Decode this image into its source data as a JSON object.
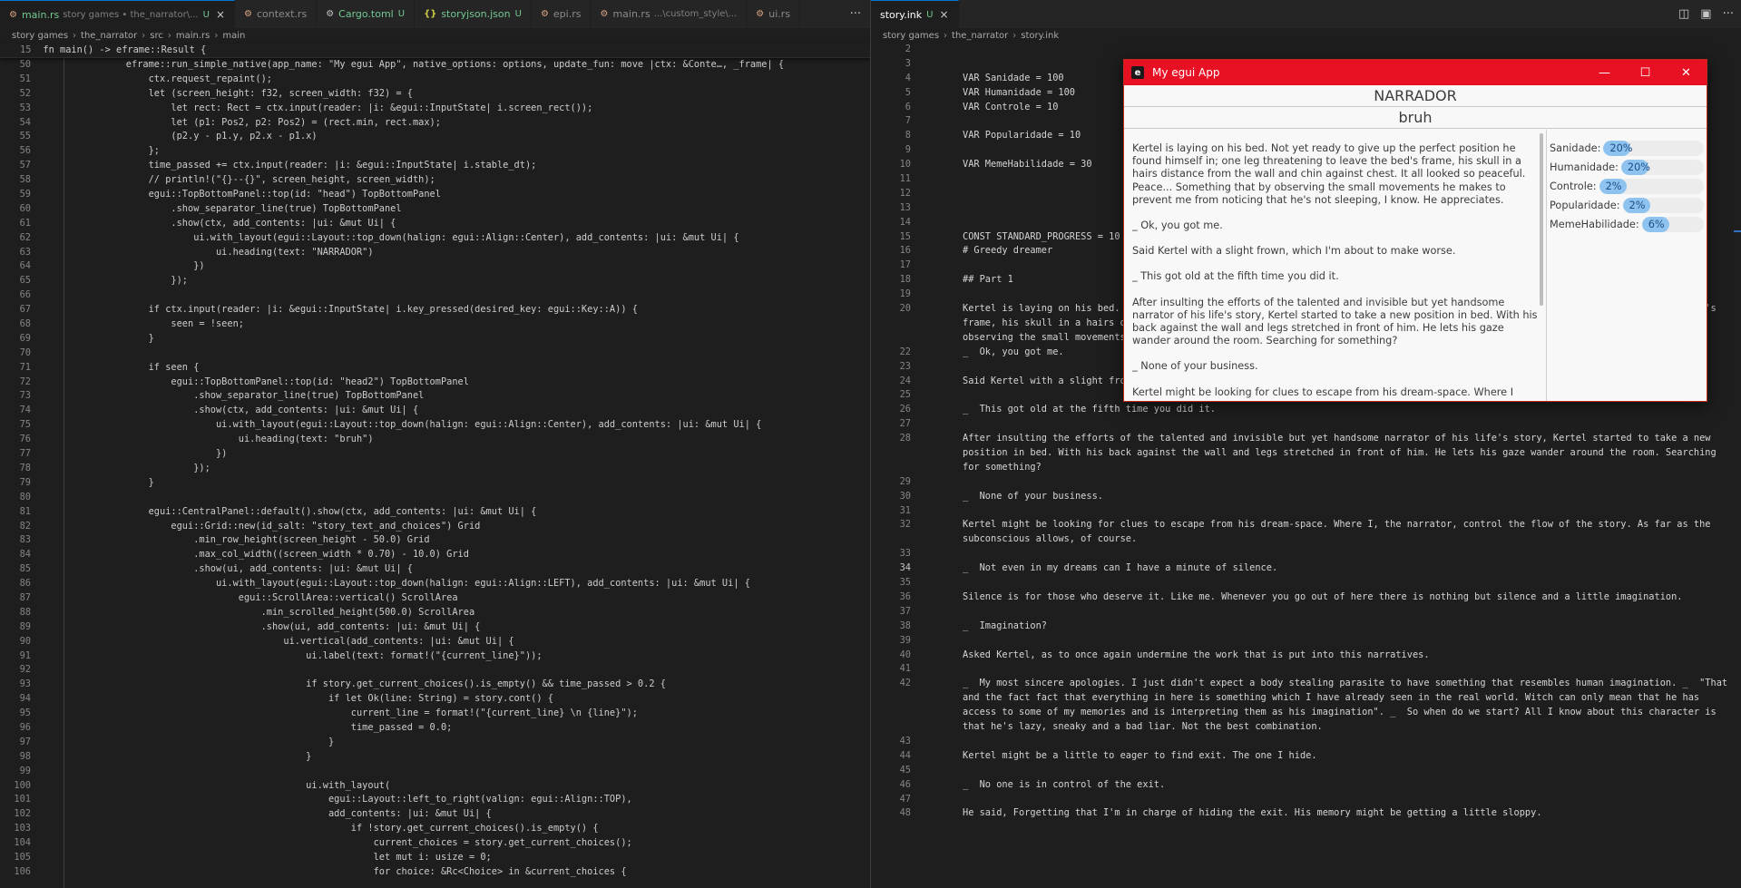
{
  "left": {
    "tabs": [
      {
        "label": "main.rs",
        "detail": "story games • the_narrator\\...",
        "status": "U",
        "icon": "rust-icon",
        "active": true
      },
      {
        "label": "context.rs",
        "detail": "",
        "status": "",
        "icon": "rust-icon",
        "active": false
      },
      {
        "label": "Cargo.toml",
        "detail": "",
        "status": "U",
        "icon": "gear-icon",
        "active": false
      },
      {
        "label": "storyjson.json",
        "detail": "",
        "status": "U",
        "icon": "json-icon",
        "active": false
      },
      {
        "label": "epi.rs",
        "detail": "",
        "status": "",
        "icon": "rust-icon",
        "active": false
      },
      {
        "label": "main.rs",
        "detail": "...\\custom_style\\...",
        "status": "",
        "icon": "rust-icon",
        "active": false
      },
      {
        "label": "ui.rs",
        "detail": "",
        "status": "",
        "icon": "rust-icon",
        "active": false
      }
    ],
    "more": "···",
    "breadcrumb": [
      "story games",
      "the_narrator",
      "src",
      "main.rs",
      "main"
    ],
    "sticky": {
      "num": "15",
      "text": "fn main() -> eframe::Result {"
    },
    "lines": [
      {
        "num": "50",
        "text": "    eframe::run_simple_native(app_name: \"My egui App\", native_options: options, update_fun: move |ctx: &Conte…, _frame| {"
      },
      {
        "num": "51",
        "text": "        ctx.request_repaint();"
      },
      {
        "num": "52",
        "text": "        let (screen_height: f32, screen_width: f32) = {"
      },
      {
        "num": "53",
        "text": "            let rect: Rect = ctx.input(reader: |i: &egui::InputState| i.screen_rect());"
      },
      {
        "num": "54",
        "text": "            let (p1: Pos2, p2: Pos2) = (rect.min, rect.max);"
      },
      {
        "num": "55",
        "text": "            (p2.y - p1.y, p2.x - p1.x)"
      },
      {
        "num": "56",
        "text": "        };"
      },
      {
        "num": "57",
        "text": "        time_passed += ctx.input(reader: |i: &egui::InputState| i.stable_dt);"
      },
      {
        "num": "58",
        "text": "        // println!(\"{}--{}\", screen_height, screen_width);"
      },
      {
        "num": "59",
        "text": "        egui::TopBottomPanel::top(id: \"head\") TopBottomPanel"
      },
      {
        "num": "60",
        "text": "            .show_separator_line(true) TopBottomPanel"
      },
      {
        "num": "61",
        "text": "            .show(ctx, add_contents: |ui: &mut Ui| {"
      },
      {
        "num": "62",
        "text": "                ui.with_layout(egui::Layout::top_down(halign: egui::Align::Center), add_contents: |ui: &mut Ui| {"
      },
      {
        "num": "63",
        "text": "                    ui.heading(text: \"NARRADOR\")"
      },
      {
        "num": "64",
        "text": "                })"
      },
      {
        "num": "65",
        "text": "            });"
      },
      {
        "num": "66",
        "text": ""
      },
      {
        "num": "67",
        "text": "        if ctx.input(reader: |i: &egui::InputState| i.key_pressed(desired_key: egui::Key::A)) {"
      },
      {
        "num": "68",
        "text": "            seen = !seen;"
      },
      {
        "num": "69",
        "text": "        }"
      },
      {
        "num": "70",
        "text": ""
      },
      {
        "num": "71",
        "text": "        if seen {"
      },
      {
        "num": "72",
        "text": "            egui::TopBottomPanel::top(id: \"head2\") TopBottomPanel"
      },
      {
        "num": "73",
        "text": "                .show_separator_line(true) TopBottomPanel"
      },
      {
        "num": "74",
        "text": "                .show(ctx, add_contents: |ui: &mut Ui| {"
      },
      {
        "num": "75",
        "text": "                    ui.with_layout(egui::Layout::top_down(halign: egui::Align::Center), add_contents: |ui: &mut Ui| {"
      },
      {
        "num": "76",
        "text": "                        ui.heading(text: \"bruh\")"
      },
      {
        "num": "77",
        "text": "                    })"
      },
      {
        "num": "78",
        "text": "                });"
      },
      {
        "num": "79",
        "text": "        }"
      },
      {
        "num": "80",
        "text": ""
      },
      {
        "num": "81",
        "text": "        egui::CentralPanel::default().show(ctx, add_contents: |ui: &mut Ui| {"
      },
      {
        "num": "82",
        "text": "            egui::Grid::new(id_salt: \"story_text_and_choices\") Grid"
      },
      {
        "num": "83",
        "text": "                .min_row_height(screen_height - 50.0) Grid"
      },
      {
        "num": "84",
        "text": "                .max_col_width((screen_width * 0.70) - 10.0) Grid"
      },
      {
        "num": "85",
        "text": "                .show(ui, add_contents: |ui: &mut Ui| {"
      },
      {
        "num": "86",
        "text": "                    ui.with_layout(egui::Layout::top_down(halign: egui::Align::LEFT), add_contents: |ui: &mut Ui| {"
      },
      {
        "num": "87",
        "text": "                        egui::ScrollArea::vertical() ScrollArea"
      },
      {
        "num": "88",
        "text": "                            .min_scrolled_height(500.0) ScrollArea"
      },
      {
        "num": "89",
        "text": "                            .show(ui, add_contents: |ui: &mut Ui| {"
      },
      {
        "num": "90",
        "text": "                                ui.vertical(add_contents: |ui: &mut Ui| {"
      },
      {
        "num": "91",
        "text": "                                    ui.label(text: format!(\"{current_line}\"));"
      },
      {
        "num": "92",
        "text": ""
      },
      {
        "num": "93",
        "text": "                                    if story.get_current_choices().is_empty() && time_passed > 0.2 {"
      },
      {
        "num": "94",
        "text": "                                        if let Ok(line: String) = story.cont() {"
      },
      {
        "num": "95",
        "text": "                                            current_line = format!(\"{current_line} \\n {line}\");"
      },
      {
        "num": "96",
        "text": "                                            time_passed = 0.0;"
      },
      {
        "num": "97",
        "text": "                                        }"
      },
      {
        "num": "98",
        "text": "                                    }"
      },
      {
        "num": "99",
        "text": ""
      },
      {
        "num": "100",
        "text": "                                    ui.with_layout("
      },
      {
        "num": "101",
        "text": "                                        egui::Layout::left_to_right(valign: egui::Align::TOP),"
      },
      {
        "num": "102",
        "text": "                                        add_contents: |ui: &mut Ui| {"
      },
      {
        "num": "103",
        "text": "                                            if !story.get_current_choices().is_empty() {"
      },
      {
        "num": "104",
        "text": "                                                current_choices = story.get_current_choices();"
      },
      {
        "num": "105",
        "text": "                                                let mut i: usize = 0;"
      },
      {
        "num": "106",
        "text": "                                                for choice: &Rc<Choice> in &current_choices {"
      }
    ]
  },
  "right": {
    "tab": {
      "label": "story.ink",
      "status": "U",
      "close": "×"
    },
    "breadcrumb": [
      "story games",
      "the_narrator",
      "story.ink"
    ],
    "lines": [
      {
        "num": "2",
        "text": ""
      },
      {
        "num": "3",
        "text": ""
      },
      {
        "num": "4",
        "text": "VAR Sanidade = 100"
      },
      {
        "num": "5",
        "text": "VAR Humanidade = 100"
      },
      {
        "num": "6",
        "text": "VAR Controle = 10"
      },
      {
        "num": "7",
        "text": ""
      },
      {
        "num": "8",
        "text": "VAR Popularidade = 10"
      },
      {
        "num": "9",
        "text": ""
      },
      {
        "num": "10",
        "text": "VAR MemeHabilidade = 30"
      },
      {
        "num": "11",
        "text": ""
      },
      {
        "num": "12",
        "text": ""
      },
      {
        "num": "13",
        "text": ""
      },
      {
        "num": "14",
        "text": ""
      },
      {
        "num": "15",
        "text": "CONST STANDARD_PROGRESS = 10"
      },
      {
        "num": "16",
        "text": "# Greedy dreamer"
      },
      {
        "num": "17",
        "text": ""
      },
      {
        "num": "18",
        "text": "## Part 1"
      },
      {
        "num": "19",
        "text": ""
      },
      {
        "num": "20",
        "text": "Kertel is laying on his bed. Not yet ready to give up the perfect position he found himself in; one leg threatening to leave the bed's frame, his skull in a hairs distance from the wall and chin against chest. It all looked so peaceful. Peace... Something that by observing the small movements he makes to prevent me from noticing that he's not sleeping, I know. He appreciates.",
        "wrap": true
      },
      {
        "num": "22",
        "text": "_  Ok, you got me."
      },
      {
        "num": "23",
        "text": ""
      },
      {
        "num": "24",
        "text": "Said Kertel with a slight frown, which I'm about to make worse."
      },
      {
        "num": "25",
        "text": ""
      },
      {
        "num": "26",
        "text": "_  This got old at the fifth time you did it."
      },
      {
        "num": "27",
        "text": ""
      },
      {
        "num": "28",
        "text": "After insulting the efforts of the talented and invisible but yet handsome narrator of his life's story, Kertel started to take a new position in bed. With his back against the wall and legs stretched in front of him. He lets his gaze wander around the room. Searching for something?",
        "wrap": true
      },
      {
        "num": "29",
        "text": ""
      },
      {
        "num": "30",
        "text": "_  None of your business."
      },
      {
        "num": "31",
        "text": ""
      },
      {
        "num": "32",
        "text": "Kertel might be looking for clues to escape from his dream-space. Where I, the narrator, control the flow of the story. As far as the subconscious allows, of course.",
        "wrap": true
      },
      {
        "num": "33",
        "text": ""
      },
      {
        "num": "34",
        "text": "_  Not even in my dreams can I have a minute of silence.",
        "current": true
      },
      {
        "num": "35",
        "text": ""
      },
      {
        "num": "36",
        "text": "Silence is for those who deserve it. Like me. Whenever you go out of here there is nothing but silence and a little imagination.",
        "wrap": true
      },
      {
        "num": "37",
        "text": ""
      },
      {
        "num": "38",
        "text": "_  Imagination?"
      },
      {
        "num": "39",
        "text": ""
      },
      {
        "num": "40",
        "text": "Asked Kertel, as to once again undermine the work that is put into this narratives."
      },
      {
        "num": "41",
        "text": ""
      },
      {
        "num": "42",
        "text": "_  My most sincere apologies. I just didn't expect a body stealing parasite to have something that resembles human imagination. _  \"That and the fact fact that everything in here is something which I have already seen in the real world. Witch can only mean that he has access to some of my memories and is interpreting them as his imagination\". _  So when do we start? All I know about this character is that he's lazy, sneaky and a bad liar. Not the best combination.",
        "wrap": true
      },
      {
        "num": "43",
        "text": ""
      },
      {
        "num": "44",
        "text": "Kertel might be a little to eager to find exit. The one I hide."
      },
      {
        "num": "45",
        "text": ""
      },
      {
        "num": "46",
        "text": "_  No one is in control of the exit."
      },
      {
        "num": "47",
        "text": ""
      },
      {
        "num": "48",
        "text": "He said, Forgetting that I'm in charge of hiding the exit. His memory might be getting a little sloppy."
      }
    ]
  },
  "egui": {
    "title": "My egui App",
    "icon_letter": "e",
    "controls": {
      "minimize": "—",
      "maximize": "☐",
      "close": "✕"
    },
    "heading": "NARRADOR",
    "heading2": "bruh",
    "story": [
      "Kertel is laying on his bed. Not yet ready to give up the perfect position he found himself in; one leg threatening to leave the bed's frame, his skull in a hairs distance from the wall and chin against chest. It all looked so peaceful. Peace... Something that by observing the small movements he makes to prevent me from noticing that he's not sleeping, I know. He appreciates.",
      "_ Ok, you got me.",
      "Said Kertel with a slight frown, which I'm about to make worse.",
      "_ This got old at the fifth time you did it.",
      "After insulting the efforts of the talented and invisible but yet handsome narrator of his life's story, Kertel started to take a new position in bed. With his back against the wall and legs stretched in front of him. He lets his gaze wander around the room. Searching for something?",
      "_ None of your business.",
      "Kertel might be looking for clues to escape from his dream-space. Where I"
    ],
    "stats": [
      {
        "label": "Sanidade:",
        "value": "20%",
        "fraction": 0.2
      },
      {
        "label": "Humanidade:",
        "value": "20%",
        "fraction": 0.2
      },
      {
        "label": "Controle:",
        "value": "2%",
        "fraction": 0.02
      },
      {
        "label": "Popularidade:",
        "value": "2%",
        "fraction": 0.02
      },
      {
        "label": "MemeHabilidade:",
        "value": "6%",
        "fraction": 0.06
      }
    ]
  }
}
